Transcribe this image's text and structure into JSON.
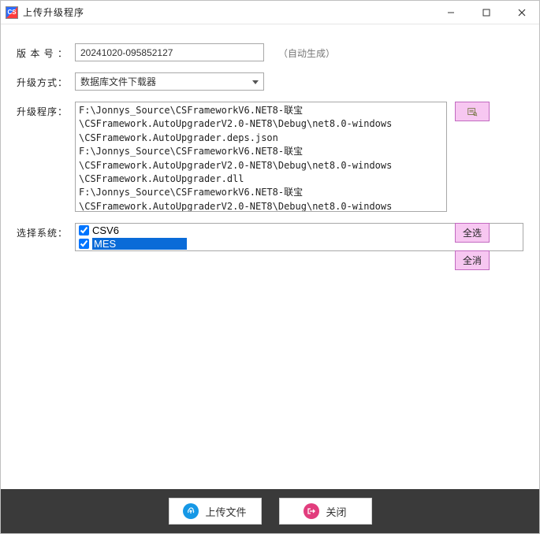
{
  "window": {
    "title": "上传升级程序"
  },
  "labels": {
    "version": "版本号：",
    "method": "升级方式：",
    "program": "升级程序：",
    "system": "选择系统：",
    "autoGen": "（自动生成）"
  },
  "version": {
    "value": "20241020-095852127"
  },
  "method": {
    "value": "数据库文件下载器"
  },
  "programPaths": "F:\\Jonnys_Source\\CSFrameworkV6.NET8-联宝\n\\CSFramework.AutoUpgraderV2.0-NET8\\Debug\\net8.0-windows\n\\CSFramework.AutoUpgrader.deps.json\nF:\\Jonnys_Source\\CSFrameworkV6.NET8-联宝\n\\CSFramework.AutoUpgraderV2.0-NET8\\Debug\\net8.0-windows\n\\CSFramework.AutoUpgrader.dll\nF:\\Jonnys_Source\\CSFrameworkV6.NET8-联宝\n\\CSFramework.AutoUpgraderV2.0-NET8\\Debug\\net8.0-windows\n\\CSFramework.AutoUpgrader.dll.config\nF:\\Jonnys_Source\\CSFrameworkV6.NET8-联宝\n\\CSFramework.AutoUpgraderV2.0-NET8\\Debug\\net8.0-windows",
  "systems": [
    {
      "name": "CSV6",
      "checked": true,
      "selected": false
    },
    {
      "name": "MES",
      "checked": true,
      "selected": true
    }
  ],
  "buttons": {
    "selectAll": "全选",
    "deselectAll": "全消",
    "upload": "上传文件",
    "close": "关闭"
  }
}
